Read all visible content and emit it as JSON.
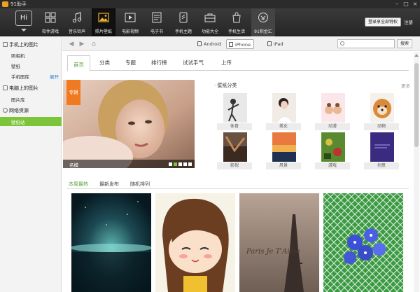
{
  "app": {
    "title": "91助手",
    "min": "–",
    "max": "□",
    "close": "×"
  },
  "toolbar": {
    "hi_label": "Hi",
    "items": [
      {
        "label": "软件游戏",
        "icon": "apps-grid-icon"
      },
      {
        "label": "音乐铃声",
        "icon": "music-note-icon"
      },
      {
        "label": "照片壁纸",
        "icon": "photo-wallpaper-icon"
      },
      {
        "label": "电影视频",
        "icon": "video-play-icon"
      },
      {
        "label": "电子书",
        "icon": "ebook-icon"
      },
      {
        "label": "手机主题",
        "icon": "phone-theme-icon"
      },
      {
        "label": "功能大全",
        "icon": "tools-icon"
      },
      {
        "label": "手机生活",
        "icon": "shopping-bag-icon"
      },
      {
        "label": "91积金汇",
        "icon": "finance-icon"
      }
    ],
    "active_index": 2,
    "login_label": "登录享全部特权",
    "register_label": "注册"
  },
  "sidebar": {
    "phone_section": "手机上的图片",
    "phone_items": [
      "照相机",
      "壁纸",
      "手机图库"
    ],
    "expand_label": "展开",
    "pc_section": "电脑上的图片",
    "pc_items": [
      "图片库"
    ],
    "net_section": "网络资源",
    "net_items": [
      "壁纸站"
    ]
  },
  "navbar": {
    "devices": [
      "Android",
      "iPhone",
      "iPad"
    ],
    "selected_device": "iPhone",
    "search_placeholder": "",
    "search_button": "搜索"
  },
  "content": {
    "tabs": [
      "首页",
      "分类",
      "专题",
      "排行榜",
      "试试手气",
      "上传"
    ],
    "active_tab": "首页",
    "hero": {
      "badge": "专辑",
      "caption": "名模",
      "slides": 5,
      "current_slide": 1
    },
    "category_title": "壁纸分类",
    "category_more": "更多",
    "categories": [
      "体育",
      "美女",
      "动漫",
      "动物",
      "影视",
      "风景",
      "游戏",
      "创意"
    ],
    "subtabs": [
      "本周最热",
      "最新发布",
      "随机排列"
    ],
    "active_subtab": "本周最热",
    "wallpaper_texts": [
      "Paris Je T'Aime"
    ]
  }
}
